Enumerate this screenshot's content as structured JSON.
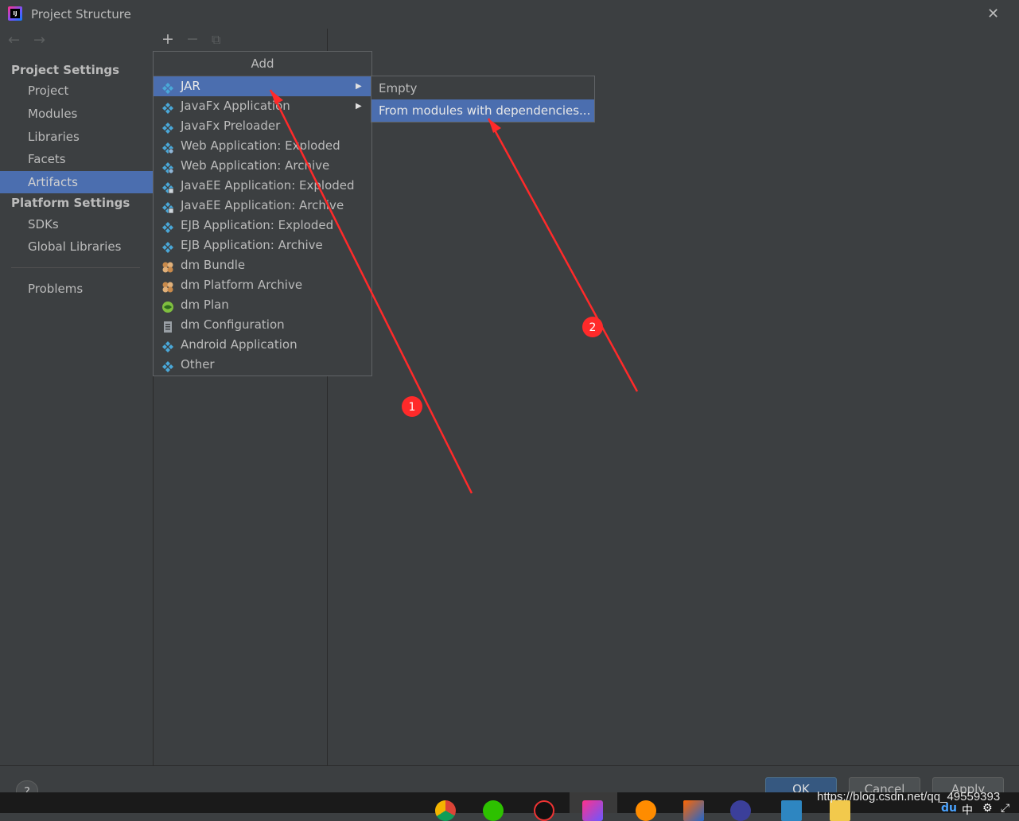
{
  "window": {
    "title": "Project Structure",
    "close_icon": "close-icon",
    "app_icon_text": "IJ"
  },
  "sidebar": {
    "project_settings_header": "Project Settings",
    "project_items": [
      "Project",
      "Modules",
      "Libraries",
      "Facets",
      "Artifacts"
    ],
    "selected": "Artifacts",
    "platform_settings_header": "Platform Settings",
    "platform_items": [
      "SDKs",
      "Global Libraries"
    ],
    "problems": "Problems"
  },
  "toolbar": {
    "add": "+",
    "remove": "−",
    "copy": "⧉"
  },
  "add_menu": {
    "title": "Add",
    "items": [
      {
        "label": "JAR",
        "icon": "artifact-icon",
        "submenu": true
      },
      {
        "label": "JavaFx Application",
        "icon": "artifact-icon",
        "submenu": true
      },
      {
        "label": "JavaFx Preloader",
        "icon": "artifact-icon"
      },
      {
        "label": "Web Application: Exploded",
        "icon": "web-artifact-icon"
      },
      {
        "label": "Web Application: Archive",
        "icon": "web-artifact-icon"
      },
      {
        "label": "JavaEE Application: Exploded",
        "icon": "javaee-artifact-icon"
      },
      {
        "label": "JavaEE Application: Archive",
        "icon": "javaee-artifact-icon"
      },
      {
        "label": "EJB Application: Exploded",
        "icon": "artifact-icon"
      },
      {
        "label": "EJB Application: Archive",
        "icon": "artifact-icon"
      },
      {
        "label": "dm Bundle",
        "icon": "bundle-icon"
      },
      {
        "label": "dm Platform Archive",
        "icon": "bundle-icon"
      },
      {
        "label": "dm Plan",
        "icon": "globe-icon"
      },
      {
        "label": "dm Configuration",
        "icon": "document-icon"
      },
      {
        "label": "Android Application",
        "icon": "artifact-icon"
      },
      {
        "label": "Other",
        "icon": "artifact-icon"
      }
    ],
    "selected": "JAR"
  },
  "jar_submenu": {
    "items": [
      "Empty",
      "From modules with dependencies..."
    ],
    "selected": "From modules with dependencies..."
  },
  "annotations": {
    "marker_1": "1",
    "marker_2": "2"
  },
  "buttons": {
    "help": "?",
    "ok": "OK",
    "cancel": "Cancel",
    "apply": "Apply"
  },
  "watermark": "https://blog.csdn.net/qq_49559393",
  "tray": {
    "ime": "中"
  },
  "colors": {
    "background": "#3c3f41",
    "selection": "#4b6eaf",
    "annotation": "#ff2a2a",
    "ok_button": "#365880"
  }
}
